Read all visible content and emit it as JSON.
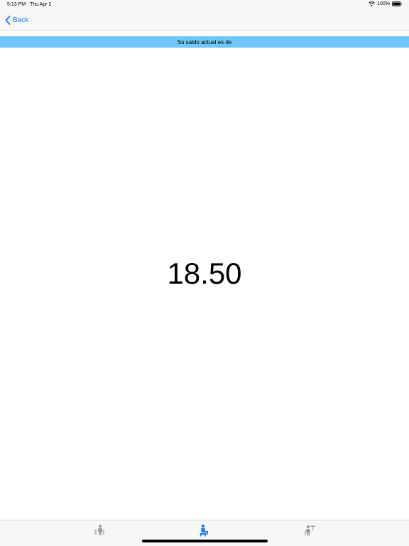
{
  "status_bar": {
    "time": "5:13 PM",
    "date": "Thu Apr 2",
    "battery": "100%",
    "icons": [
      "wifi-icon",
      "battery-icon"
    ]
  },
  "nav": {
    "back_label": "Back",
    "back_icon": "chevron-left-icon"
  },
  "banner": {
    "text": "Su saldo actual es de"
  },
  "balance": {
    "value": "18.50"
  },
  "tab_bar": {
    "items": [
      {
        "icon": "people-icon",
        "active": false
      },
      {
        "icon": "person-sitting-icon",
        "active": true
      },
      {
        "icon": "person-umbrella-icon",
        "active": false
      }
    ]
  },
  "colors": {
    "accent": "#1a7cf5",
    "banner": "#6ec6fa",
    "bar_background": "#f7f7f7",
    "inactive_icon": "#9a9a9a"
  }
}
